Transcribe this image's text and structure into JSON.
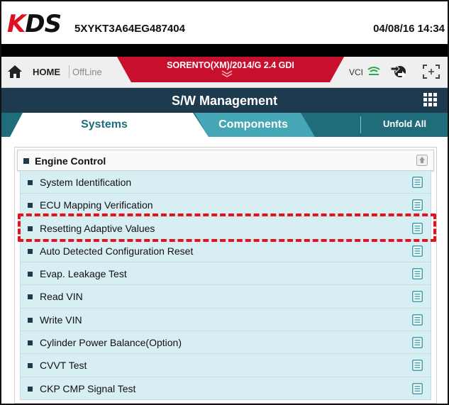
{
  "header": {
    "logo": "KDS",
    "vin": "5XYKT3A64EG487404",
    "datetime": "04/08/16 14:34"
  },
  "nav": {
    "home_label": "HOME",
    "status": "OffLine",
    "vehicle": "SORENTO(XM)/2014/G 2.4 GDI",
    "vci_label": "VCI"
  },
  "titlebar": {
    "title": "S/W Management"
  },
  "tabs": {
    "systems": "Systems",
    "components": "Components",
    "unfold_all": "Unfold All",
    "active": "Systems"
  },
  "group": {
    "label": "Engine Control",
    "items": [
      {
        "label": "System Identification"
      },
      {
        "label": "ECU Mapping Verification"
      },
      {
        "label": "Resetting Adaptive Values"
      },
      {
        "label": "Auto Detected Configuration Reset"
      },
      {
        "label": "Evap. Leakage Test"
      },
      {
        "label": "Read VIN"
      },
      {
        "label": "Write VIN"
      },
      {
        "label": "Cylinder Power Balance(Option)"
      },
      {
        "label": "CVVT Test"
      },
      {
        "label": "CKP CMP Signal Test"
      }
    ]
  },
  "colors": {
    "accent_red": "#c8102e",
    "titlebar": "#1d3a4f",
    "tabbar": "#1f6d7a",
    "row_bg": "#d7eef2",
    "highlight": "#e8101a"
  }
}
